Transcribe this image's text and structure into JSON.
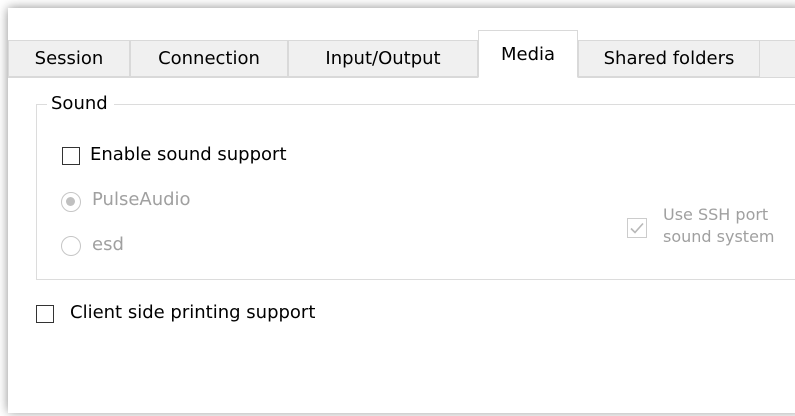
{
  "tabs": [
    {
      "label": "Session"
    },
    {
      "label": "Connection"
    },
    {
      "label": "Input/Output"
    },
    {
      "label": "Media"
    },
    {
      "label": "Shared folders"
    }
  ],
  "active_tab": "Media",
  "sound_group": {
    "title": "Sound",
    "enable_sound_label": "Enable sound support",
    "enable_sound_checked": false,
    "radio_options": [
      {
        "label": "PulseAudio",
        "selected": true
      },
      {
        "label": "esd",
        "selected": false
      }
    ],
    "ssh_port_line1": "Use SSH port",
    "ssh_port_line2": "sound system",
    "ssh_port_checked": true
  },
  "printing": {
    "label": "Client side printing support",
    "checked": false
  },
  "colors": {
    "tab_inactive_bg": "#f0f0f0",
    "disabled_text": "#a0a0a0",
    "border": "#d9d9d9"
  }
}
